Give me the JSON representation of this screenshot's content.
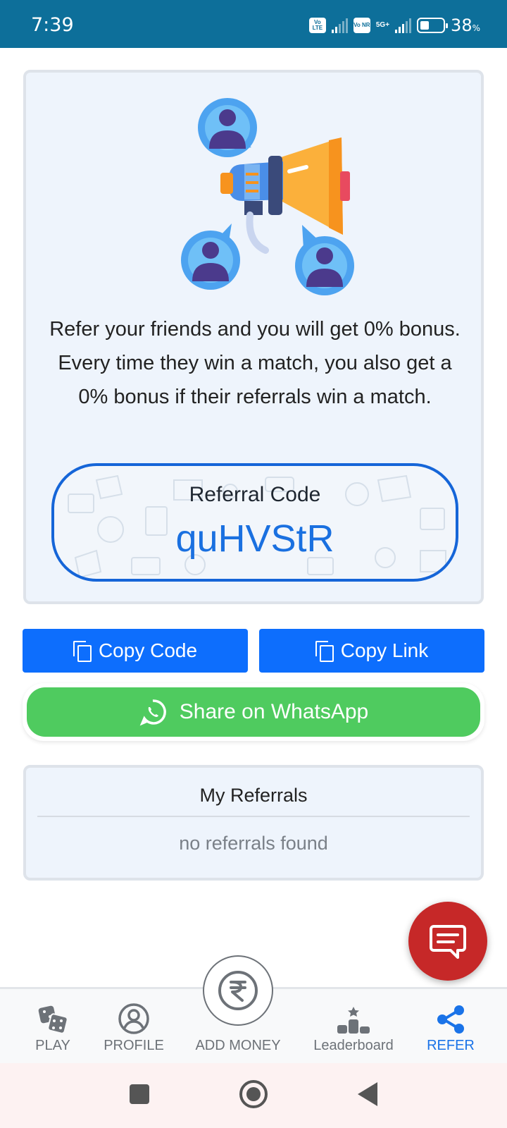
{
  "status_bar": {
    "time": "7:39",
    "volte_label": "Vo LTE",
    "vonr_label": "Vo NR",
    "network": "5G+",
    "battery_value": "38",
    "battery_unit": "%"
  },
  "referral_card": {
    "description": "Refer your friends and you will get 0% bonus. Every time they win a match, you also get a 0% bonus if their referrals win a match.",
    "code_label": "Referral Code",
    "code": "quHVStR"
  },
  "actions": {
    "copy_code": "Copy Code",
    "copy_link": "Copy Link",
    "share_whatsapp": "Share on WhatsApp"
  },
  "my_referrals": {
    "title": "My Referrals",
    "empty_text": "no referrals found"
  },
  "bottom_nav": {
    "items": [
      {
        "label": "PLAY",
        "icon": "dice-icon"
      },
      {
        "label": "PROFILE",
        "icon": "user-circle-icon"
      },
      {
        "label": "ADD MONEY",
        "icon": "rupee-icon"
      },
      {
        "label": "Leaderboard",
        "icon": "podium-icon"
      },
      {
        "label": "REFER",
        "icon": "share-icon"
      }
    ],
    "active": "REFER"
  },
  "colors": {
    "status_bar": "#0d6f9a",
    "primary_button": "#0d6efd",
    "whatsapp": "#4fcb5f",
    "chat_fab": "#c62828",
    "active_nav": "#1a73e8"
  }
}
